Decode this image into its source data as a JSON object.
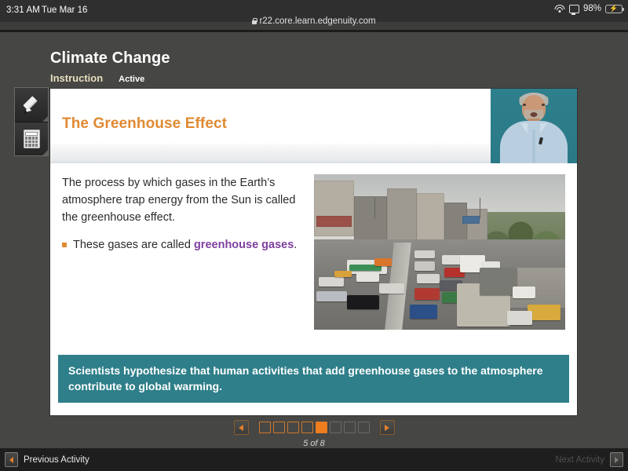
{
  "status_bar": {
    "time": "3:31 AM",
    "date": "Tue Mar 16",
    "wifi_icon": "wifi-icon",
    "mirroring_icon": "screen-mirroring-icon",
    "battery_percent": "98%",
    "battery_icon": "battery-charging-icon",
    "battery_color": "#3ad35a"
  },
  "browser": {
    "lock_icon": "lock-icon",
    "url": "r22.core.learn.edgenuity.com"
  },
  "lesson": {
    "title": "Climate Change",
    "tabs": [
      {
        "label": "Instruction",
        "active": true
      },
      {
        "label": "Active",
        "active": false
      }
    ]
  },
  "tools": [
    {
      "name": "highlighter-tool",
      "icon": "pencil-icon"
    },
    {
      "name": "calculator-tool",
      "icon": "calculator-icon"
    }
  ],
  "slide": {
    "heading": "The Greenhouse Effect",
    "heading_color": "#e08a33",
    "paragraph": "The process by which gases in the Earth’s atmosphere trap energy from the Sun is called the greenhouse effect.",
    "bullet": {
      "lead": "These gases are called ",
      "emphasis": "greenhouse gases",
      "trail": ".",
      "emphasis_color": "#7d3f9e"
    },
    "banner": {
      "text": "Scientists hypothesize that human activities that add greenhouse gases to the atmosphere contribute to global warming.",
      "background": "#2e7f8a"
    },
    "photo_alt": "city-traffic-jam-photo",
    "video_alt": "instructor-video"
  },
  "pager": {
    "prev_icon": "arrow-left-icon",
    "next_icon": "arrow-right-icon",
    "label": "5 of 8",
    "current": 5,
    "total": 8,
    "accent_color": "#ef7d1e"
  },
  "bottom_bar": {
    "previous_label": "Previous Activity",
    "previous_enabled": true,
    "next_label": "Next Activity",
    "next_enabled": false
  }
}
